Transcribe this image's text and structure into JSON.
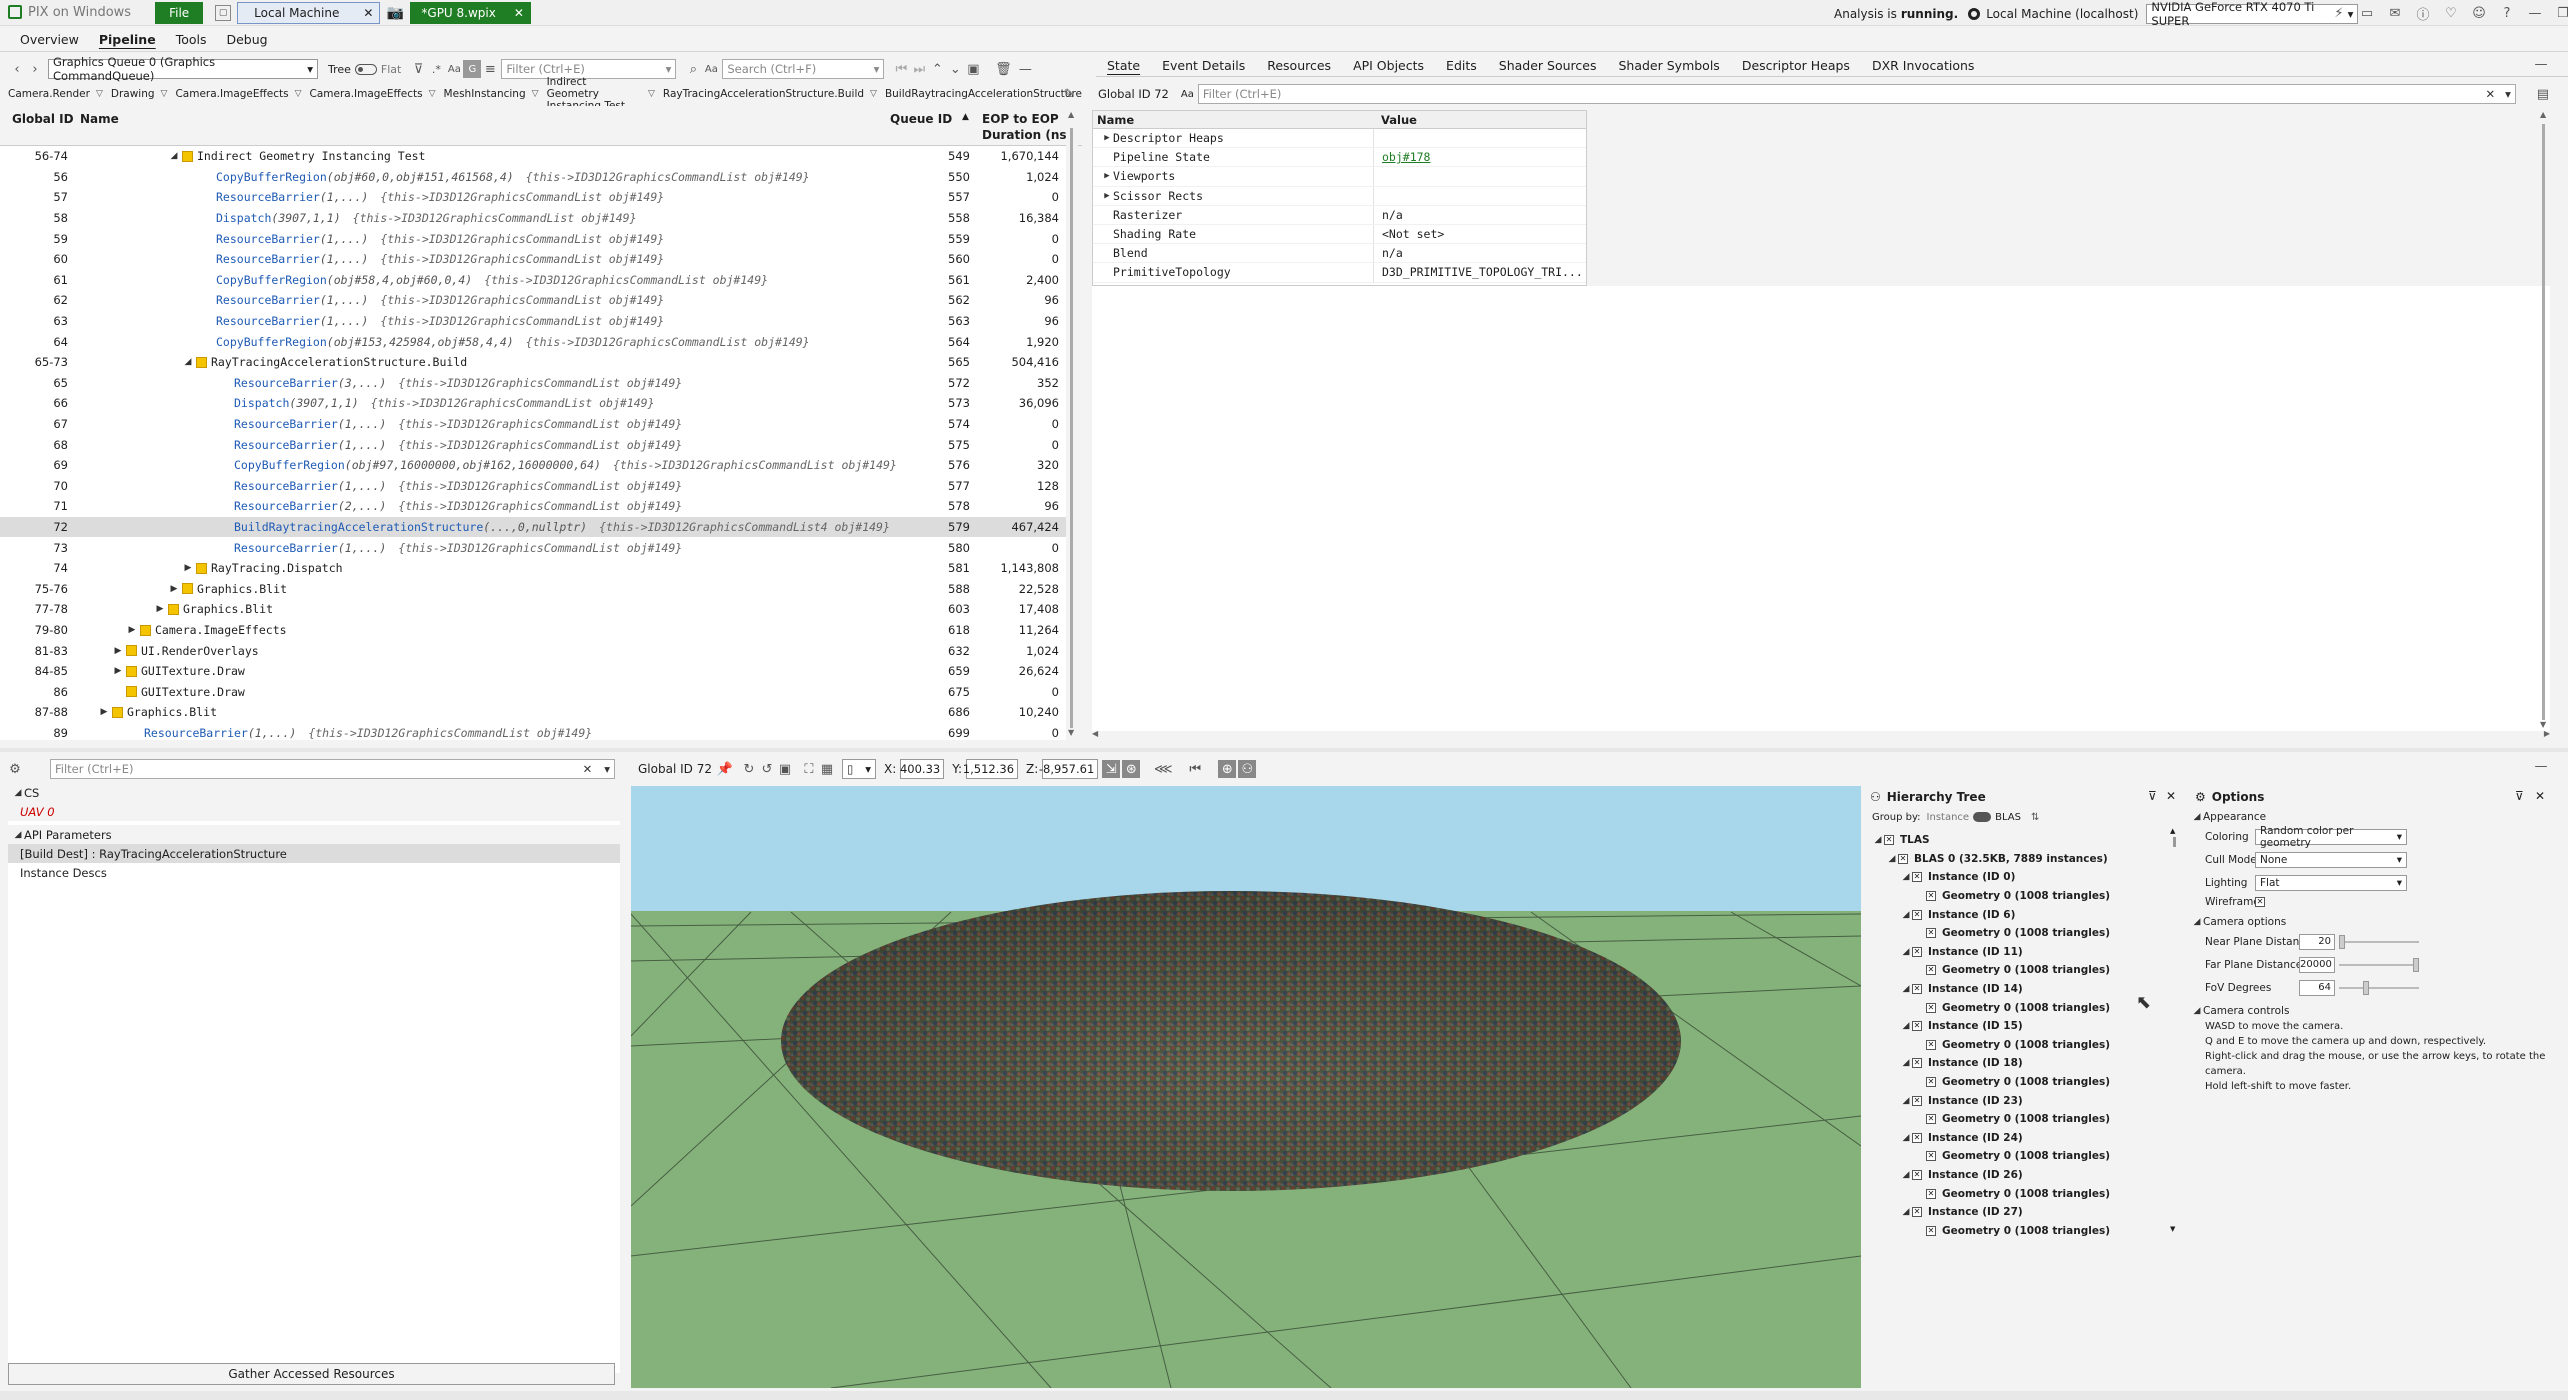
{
  "titlebar": {
    "app_name": "PIX on Windows",
    "file_label": "File",
    "tab_local": "Local Machine",
    "tab_capture": "*GPU 8.wpix",
    "analysis_prefix": "Analysis is",
    "analysis_status": "running.",
    "machine": "Local Machine (localhost)",
    "gpu": "NVIDIA GeForce RTX 4070 Ti SUPER"
  },
  "menu": [
    "Overview",
    "Pipeline",
    "Tools",
    "Debug"
  ],
  "left_toolbar": {
    "queue": "Graphics Queue 0 (Graphics CommandQueue)",
    "tree_label": "Tree",
    "flat_label": "Flat",
    "filter_placeholder": "Filter (Ctrl+E)",
    "search_placeholder": "Search (Ctrl+F)",
    "aa": "Aa"
  },
  "breadcrumb": [
    "Camera.Render",
    "Drawing",
    "Camera.ImageEffects",
    "Camera.ImageEffects",
    "MeshInstancing",
    "Indirect Geometry Instancing Test",
    "RayTracingAccelerationStructure.Build",
    "BuildRaytracingAccelerationStructure"
  ],
  "events": {
    "columns": {
      "gid": "Global ID",
      "name": "Name",
      "qid": "Queue ID",
      "dur1": "EOP to EOP",
      "dur2": "Duration (ns)"
    },
    "rows": [
      {
        "gid": "56-74",
        "indent": 0,
        "type": "group",
        "exp": "open",
        "name": "Indirect Geometry Instancing Test",
        "qid": "549",
        "dur": "1,670,144"
      },
      {
        "gid": "56",
        "indent": 1,
        "type": "api",
        "name": "CopyBufferRegion",
        "args": "(obj#60,0,obj#151,461568,4)",
        "this": "{this->ID3D12GraphicsCommandList obj#149}",
        "qid": "550",
        "dur": "1,024"
      },
      {
        "gid": "57",
        "indent": 1,
        "type": "api",
        "name": "ResourceBarrier",
        "args": "(1,...)",
        "this": "{this->ID3D12GraphicsCommandList obj#149}",
        "qid": "557",
        "dur": "0"
      },
      {
        "gid": "58",
        "indent": 1,
        "type": "api",
        "name": "Dispatch",
        "args": "(3907,1,1)",
        "this": "{this->ID3D12GraphicsCommandList obj#149}",
        "qid": "558",
        "dur": "16,384"
      },
      {
        "gid": "59",
        "indent": 1,
        "type": "api",
        "name": "ResourceBarrier",
        "args": "(1,...)",
        "this": "{this->ID3D12GraphicsCommandList obj#149}",
        "qid": "559",
        "dur": "0"
      },
      {
        "gid": "60",
        "indent": 1,
        "type": "api",
        "name": "ResourceBarrier",
        "args": "(1,...)",
        "this": "{this->ID3D12GraphicsCommandList obj#149}",
        "qid": "560",
        "dur": "0"
      },
      {
        "gid": "61",
        "indent": 1,
        "type": "api",
        "name": "CopyBufferRegion",
        "args": "(obj#58,4,obj#60,0,4)",
        "this": "{this->ID3D12GraphicsCommandList obj#149}",
        "qid": "561",
        "dur": "2,400"
      },
      {
        "gid": "62",
        "indent": 1,
        "type": "api",
        "name": "ResourceBarrier",
        "args": "(1,...)",
        "this": "{this->ID3D12GraphicsCommandList obj#149}",
        "qid": "562",
        "dur": "96"
      },
      {
        "gid": "63",
        "indent": 1,
        "type": "api",
        "name": "ResourceBarrier",
        "args": "(1,...)",
        "this": "{this->ID3D12GraphicsCommandList obj#149}",
        "qid": "563",
        "dur": "96"
      },
      {
        "gid": "64",
        "indent": 1,
        "type": "api",
        "name": "CopyBufferRegion",
        "args": "(obj#153,425984,obj#58,4,4)",
        "this": "{this->ID3D12GraphicsCommandList obj#149}",
        "qid": "564",
        "dur": "1,920"
      },
      {
        "gid": "65-73",
        "indent": 1,
        "type": "group",
        "exp": "open",
        "name": "RayTracingAccelerationStructure.Build",
        "qid": "565",
        "dur": "504,416"
      },
      {
        "gid": "65",
        "indent": 2,
        "type": "api",
        "name": "ResourceBarrier",
        "args": "(3,...)",
        "this": "{this->ID3D12GraphicsCommandList obj#149}",
        "qid": "572",
        "dur": "352"
      },
      {
        "gid": "66",
        "indent": 2,
        "type": "api",
        "name": "Dispatch",
        "args": "(3907,1,1)",
        "this": "{this->ID3D12GraphicsCommandList obj#149}",
        "qid": "573",
        "dur": "36,096"
      },
      {
        "gid": "67",
        "indent": 2,
        "type": "api",
        "name": "ResourceBarrier",
        "args": "(1,...)",
        "this": "{this->ID3D12GraphicsCommandList obj#149}",
        "qid": "574",
        "dur": "0"
      },
      {
        "gid": "68",
        "indent": 2,
        "type": "api",
        "name": "ResourceBarrier",
        "args": "(1,...)",
        "this": "{this->ID3D12GraphicsCommandList obj#149}",
        "qid": "575",
        "dur": "0"
      },
      {
        "gid": "69",
        "indent": 2,
        "type": "api",
        "name": "CopyBufferRegion",
        "args": "(obj#97,16000000,obj#162,16000000,64)",
        "this": "{this->ID3D12GraphicsCommandList obj#149}",
        "qid": "576",
        "dur": "320"
      },
      {
        "gid": "70",
        "indent": 2,
        "type": "api",
        "name": "ResourceBarrier",
        "args": "(1,...)",
        "this": "{this->ID3D12GraphicsCommandList obj#149}",
        "qid": "577",
        "dur": "128"
      },
      {
        "gid": "71",
        "indent": 2,
        "type": "api",
        "name": "ResourceBarrier",
        "args": "(2,...)",
        "this": "{this->ID3D12GraphicsCommandList obj#149}",
        "qid": "578",
        "dur": "96"
      },
      {
        "gid": "72",
        "indent": 2,
        "type": "api",
        "sel": true,
        "name": "BuildRaytracingAccelerationStructure",
        "args": "(...,0,nullptr)",
        "this": "{this->ID3D12GraphicsCommandList4 obj#149}",
        "qid": "579",
        "dur": "467,424"
      },
      {
        "gid": "73",
        "indent": 2,
        "type": "api",
        "name": "ResourceBarrier",
        "args": "(1,...)",
        "this": "{this->ID3D12GraphicsCommandList obj#149}",
        "qid": "580",
        "dur": "0"
      },
      {
        "gid": "74",
        "indent": 1,
        "type": "group",
        "exp": "closed",
        "name": "RayTracing.Dispatch",
        "qid": "581",
        "dur": "1,143,808"
      },
      {
        "gid": "75-76",
        "indent": 0,
        "type": "group",
        "exp": "closed",
        "name": "Graphics.Blit",
        "qid": "588",
        "dur": "22,528"
      },
      {
        "gid": "77-78",
        "indent": -1,
        "type": "group",
        "exp": "closed",
        "name": "Graphics.Blit",
        "qid": "603",
        "dur": "17,408"
      },
      {
        "gid": "79-80",
        "indent": -3,
        "type": "group",
        "exp": "closed",
        "name": "Camera.ImageEffects",
        "qid": "618",
        "dur": "11,264"
      },
      {
        "gid": "81-83",
        "indent": -4,
        "type": "group",
        "exp": "closed",
        "name": "UI.RenderOverlays",
        "qid": "632",
        "dur": "1,024"
      },
      {
        "gid": "84-85",
        "indent": -4,
        "type": "group",
        "exp": "closed",
        "name": "GUITexture.Draw",
        "qid": "659",
        "dur": "26,624"
      },
      {
        "gid": "86",
        "indent": -4,
        "type": "group",
        "exp": "none",
        "name": "GUITexture.Draw",
        "qid": "675",
        "dur": "0"
      },
      {
        "gid": "87-88",
        "indent": -5,
        "type": "group",
        "exp": "closed",
        "name": "Graphics.Blit",
        "qid": "686",
        "dur": "10,240"
      },
      {
        "gid": "89",
        "indent": -5,
        "type": "api",
        "name": "ResourceBarrier",
        "args": "(1,...)",
        "this": "{this->ID3D12GraphicsCommandList obj#149}",
        "qid": "699",
        "dur": "0"
      }
    ]
  },
  "right_tabs": [
    "State",
    "Event Details",
    "Resources",
    "API Objects",
    "Edits",
    "Shader Sources",
    "Shader Symbols",
    "Descriptor Heaps",
    "DXR Invocations"
  ],
  "right_filter": {
    "label": "Global ID 72",
    "aa": "Aa",
    "placeholder": "Filter (Ctrl+E)"
  },
  "state": {
    "col_name": "Name",
    "col_value": "Value",
    "rows": [
      {
        "k": "Descriptor Heaps",
        "v": "",
        "exp": true
      },
      {
        "k": "Pipeline State",
        "v": "obj#178",
        "link": true
      },
      {
        "k": "Viewports",
        "v": "",
        "exp": true
      },
      {
        "k": "Scissor Rects",
        "v": "",
        "exp": true
      },
      {
        "k": "Rasterizer",
        "v": "n/a"
      },
      {
        "k": "Shading Rate",
        "v": "<Not set>"
      },
      {
        "k": "Blend",
        "v": "n/a"
      },
      {
        "k": "PrimitiveTopology",
        "v": "D3D_PRIMITIVE_TOPOLOGY_TRI..."
      }
    ]
  },
  "bottom_left": {
    "filter_placeholder": "Filter (Ctrl+E)",
    "cs": "CS",
    "uav": "UAV 0",
    "api_params": "API Parameters",
    "build_dest": "[Build Dest] : RayTracingAccelerationStructure",
    "instance_descs": "Instance Descs",
    "gather": "Gather Accessed Resources"
  },
  "viewport_toolbar": {
    "gid": "Global ID 72",
    "x_label": "X:",
    "x": "400.33",
    "y_label": "Y:",
    "y": "1,512.36",
    "z_label": "Z:",
    "z": "-8,957.61"
  },
  "hierarchy": {
    "title": "Hierarchy Tree",
    "group_by": "Group by:",
    "instance": "Instance",
    "blas": "BLAS",
    "tlas": "TLAS",
    "blas0": "BLAS 0 (32.5KB, 7889 instances)",
    "items": [
      {
        "inst": "Instance (ID 0)",
        "geo": "Geometry 0 (1008 triangles)"
      },
      {
        "inst": "Instance (ID 6)",
        "geo": "Geometry 0 (1008 triangles)"
      },
      {
        "inst": "Instance (ID 11)",
        "geo": "Geometry 0 (1008 triangles)"
      },
      {
        "inst": "Instance (ID 14)",
        "geo": "Geometry 0 (1008 triangles)"
      },
      {
        "inst": "Instance (ID 15)",
        "geo": "Geometry 0 (1008 triangles)"
      },
      {
        "inst": "Instance (ID 18)",
        "geo": "Geometry 0 (1008 triangles)"
      },
      {
        "inst": "Instance (ID 23)",
        "geo": "Geometry 0 (1008 triangles)"
      },
      {
        "inst": "Instance (ID 24)",
        "geo": "Geometry 0 (1008 triangles)"
      },
      {
        "inst": "Instance (ID 26)",
        "geo": "Geometry 0 (1008 triangles)"
      },
      {
        "inst": "Instance (ID 27)",
        "geo": "Geometry 0 (1008 triangles)"
      }
    ]
  },
  "options": {
    "title": "Options",
    "appearance": "Appearance",
    "coloring_label": "Coloring",
    "coloring": "Random color per geometry",
    "cull_label": "Cull Mode",
    "cull": "None",
    "lighting_label": "Lighting",
    "lighting": "Flat",
    "wireframe_label": "Wireframe",
    "camera_options": "Camera options",
    "near_label": "Near Plane Distance",
    "near": "20",
    "far_label": "Far Plane Distance",
    "far": "20000",
    "fov_label": "FoV Degrees",
    "fov": "64",
    "camera_controls": "Camera controls",
    "help": [
      "WASD to move the camera.",
      "Q and E to move the camera up and down, respectively.",
      "Right-click and drag the mouse, or use the arrow keys, to rotate the camera.",
      "Hold left-shift to move faster."
    ]
  },
  "colors": {
    "accent_green": "#1f7d24",
    "api_blue": "#1f5bb5",
    "folder": "#f5c400",
    "sky": "#a8d7ec",
    "ground": "#85b27a"
  }
}
